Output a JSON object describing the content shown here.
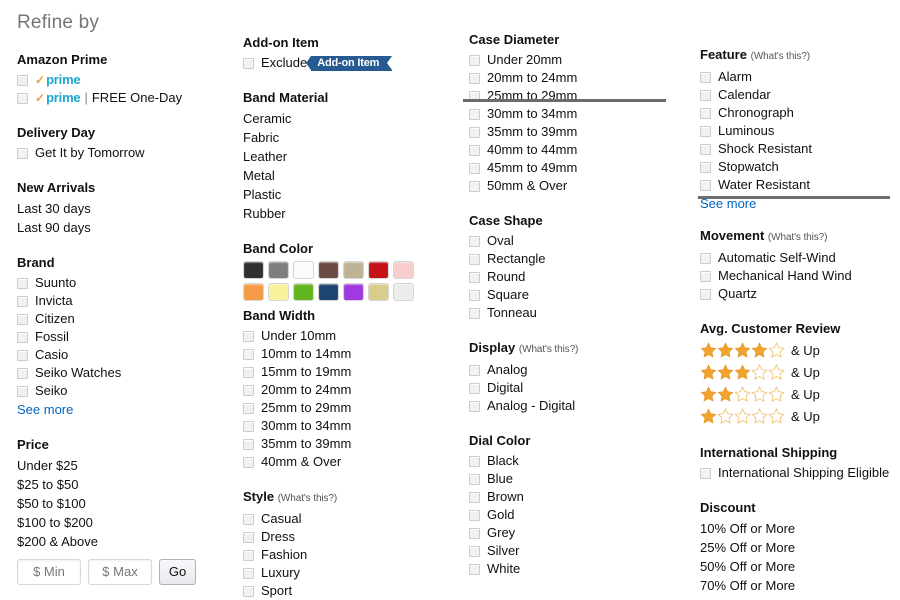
{
  "page": {
    "title": "Refine by"
  },
  "colors": {
    "link": "#0066c0",
    "prime_blue": "#1ba7d0",
    "prime_orange": "#f79b34",
    "badge_blue": "#265a91",
    "star_gold": "#f0a32e",
    "rule_gray": "#6b6b6b"
  },
  "column1": {
    "amazon_prime": {
      "title": "Amazon Prime",
      "items": [
        {
          "check": "✓",
          "word": "prime",
          "separator": "",
          "extra": ""
        },
        {
          "check": "✓",
          "word": "prime",
          "separator": "|",
          "extra": "FREE One-Day"
        }
      ]
    },
    "delivery_day": {
      "title": "Delivery Day",
      "items": [
        "Get It by Tomorrow"
      ]
    },
    "new_arrivals": {
      "title": "New Arrivals",
      "items": [
        "Last 30 days",
        "Last 90 days"
      ]
    },
    "brand": {
      "title": "Brand",
      "items": [
        "Suunto",
        "Invicta",
        "Citizen",
        "Fossil",
        "Casio",
        "Seiko Watches",
        "Seiko"
      ],
      "see_more": "See more"
    },
    "price": {
      "title": "Price",
      "items": [
        "Under $25",
        "$25 to $50",
        "$50 to $100",
        "$100 to $200",
        "$200 & Above"
      ],
      "min_placeholder": "$ Min",
      "max_placeholder": "$ Max",
      "go_label": "Go"
    }
  },
  "column2": {
    "addon_item": {
      "title": "Add-on Item",
      "exclude_label": "Exclude",
      "badge_label": "Add-on Item"
    },
    "band_material": {
      "title": "Band Material",
      "items": [
        "Ceramic",
        "Fabric",
        "Leather",
        "Metal",
        "Plastic",
        "Rubber"
      ]
    },
    "band_color": {
      "title": "Band Color",
      "swatches": [
        {
          "name": "black",
          "hex": "#2f2f2f"
        },
        {
          "name": "grey",
          "hex": "#7e7e7c"
        },
        {
          "name": "white",
          "hex": "#fbfbfb"
        },
        {
          "name": "brown",
          "hex": "#6b4a43"
        },
        {
          "name": "beige",
          "hex": "#bdb394"
        },
        {
          "name": "red",
          "hex": "#c41217"
        },
        {
          "name": "pink",
          "hex": "#f8cdcd"
        },
        {
          "name": "orange",
          "hex": "#f59b48"
        },
        {
          "name": "yellow",
          "hex": "#f6f39a"
        },
        {
          "name": "green",
          "hex": "#62b521"
        },
        {
          "name": "navy",
          "hex": "#1e4570"
        },
        {
          "name": "purple",
          "hex": "#9f3ae0"
        },
        {
          "name": "gold",
          "hex": "#d9cd8c"
        },
        {
          "name": "off-white",
          "hex": "#ececec"
        }
      ]
    },
    "band_width": {
      "title": "Band Width",
      "items": [
        "Under 10mm",
        "10mm to 14mm",
        "15mm to 19mm",
        "20mm to 24mm",
        "25mm to 29mm",
        "30mm to 34mm",
        "35mm to 39mm",
        "40mm & Over"
      ]
    },
    "style": {
      "title": "Style",
      "whats_this": "(What's this?)",
      "items": [
        "Casual",
        "Dress",
        "Fashion",
        "Luxury",
        "Sport"
      ]
    }
  },
  "column3": {
    "case_diameter": {
      "title": "Case Diameter",
      "items": [
        "Under 20mm",
        "20mm to 24mm",
        "25mm to 29mm",
        "30mm to 34mm",
        "35mm to 39mm",
        "40mm to 44mm",
        "45mm to 49mm",
        "50mm & Over"
      ]
    },
    "case_shape": {
      "title": "Case Shape",
      "items": [
        "Oval",
        "Rectangle",
        "Round",
        "Square",
        "Tonneau"
      ]
    },
    "display": {
      "title": "Display",
      "whats_this": "(What's this?)",
      "items": [
        "Analog",
        "Digital",
        "Analog - Digital"
      ]
    },
    "dial_color": {
      "title": "Dial Color",
      "items": [
        "Black",
        "Blue",
        "Brown",
        "Gold",
        "Grey",
        "Silver",
        "White"
      ]
    }
  },
  "column4": {
    "feature": {
      "title": "Feature",
      "whats_this": "(What's this?)",
      "items": [
        "Alarm",
        "Calendar",
        "Chronograph",
        "Luminous",
        "Shock Resistant",
        "Stopwatch",
        "Water Resistant"
      ],
      "see_more": "See more"
    },
    "movement": {
      "title": "Movement",
      "whats_this": "(What's this?)",
      "items": [
        "Automatic Self-Wind",
        "Mechanical Hand Wind",
        "Quartz"
      ]
    },
    "avg_customer_review": {
      "title": "Avg. Customer Review",
      "rows": [
        {
          "stars": 4,
          "label": "& Up"
        },
        {
          "stars": 3,
          "label": "& Up"
        },
        {
          "stars": 2,
          "label": "& Up"
        },
        {
          "stars": 1,
          "label": "& Up"
        }
      ]
    },
    "international_shipping": {
      "title": "International Shipping",
      "items": [
        "International Shipping Eligible"
      ]
    },
    "discount": {
      "title": "Discount",
      "items": [
        "10% Off or More",
        "25% Off or More",
        "50% Off or More",
        "70% Off or More"
      ]
    }
  }
}
